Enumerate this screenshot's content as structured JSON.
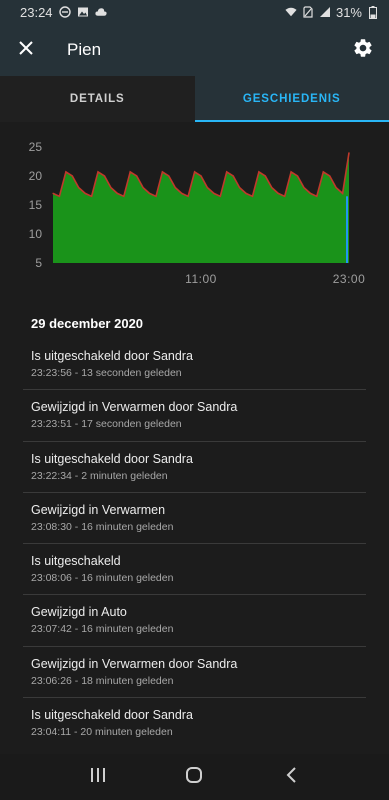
{
  "status_bar": {
    "time": "23:24",
    "battery": "31%",
    "icons": [
      "dnd-icon",
      "image-icon",
      "cloud-icon",
      "wifi-icon",
      "no-sim-icon",
      "signal-icon",
      "battery-icon"
    ]
  },
  "header": {
    "title": "Pien",
    "close_icon": "close-icon",
    "settings_icon": "gear-icon"
  },
  "tabs": [
    {
      "label": "DETAILS",
      "active": false
    },
    {
      "label": "GESCHIEDENIS",
      "active": true
    }
  ],
  "colors": {
    "accent": "#29b6f6",
    "chart_fill": "#1a9a1a",
    "chart_line": "#c0392b",
    "chart_target": "#2196f3"
  },
  "chart_data": {
    "type": "area",
    "y_ticks": [
      "25",
      "20",
      "15",
      "10",
      "5"
    ],
    "ylim": [
      5,
      25
    ],
    "x_ticks": [
      {
        "label": "11:00",
        "t": 0.5
      },
      {
        "label": "23:00",
        "t": 1.0
      }
    ],
    "series": [
      {
        "name": "",
        "values": [
          17,
          16.5,
          20.7,
          20,
          18,
          17,
          16.5,
          20.7,
          20,
          18,
          17,
          16.5,
          20.7,
          20,
          18,
          17,
          16.5,
          20.7,
          20,
          18,
          17,
          16.5,
          20.7,
          20,
          18,
          17,
          16.5,
          20.7,
          20,
          18,
          17,
          16.5,
          20.7,
          20,
          18,
          17,
          16.5,
          20.7,
          20,
          18,
          17,
          16.5,
          20.7,
          20,
          18,
          17,
          24
        ]
      }
    ]
  },
  "date_heading": "29 december 2020",
  "history": [
    {
      "title": "Is uitgeschakeld door Sandra",
      "subtitle": "23:23:56 - 13 seconden geleden"
    },
    {
      "title": "Gewijzigd in Verwarmen door Sandra",
      "subtitle": "23:23:51 - 17 seconden geleden"
    },
    {
      "title": "Is uitgeschakeld door Sandra",
      "subtitle": "23:22:34 - 2 minuten geleden"
    },
    {
      "title": "Gewijzigd in Verwarmen",
      "subtitle": "23:08:30 - 16 minuten geleden"
    },
    {
      "title": "Is uitgeschakeld",
      "subtitle": "23:08:06 - 16 minuten geleden"
    },
    {
      "title": "Gewijzigd in Auto",
      "subtitle": "23:07:42 - 16 minuten geleden"
    },
    {
      "title": "Gewijzigd in Verwarmen door Sandra",
      "subtitle": "23:06:26 - 18 minuten geleden"
    },
    {
      "title": "Is uitgeschakeld door Sandra",
      "subtitle": "23:04:11 - 20 minuten geleden"
    }
  ],
  "nav": {
    "recents_icon": "recents-icon",
    "home_icon": "home-icon",
    "back_icon": "back-icon"
  }
}
